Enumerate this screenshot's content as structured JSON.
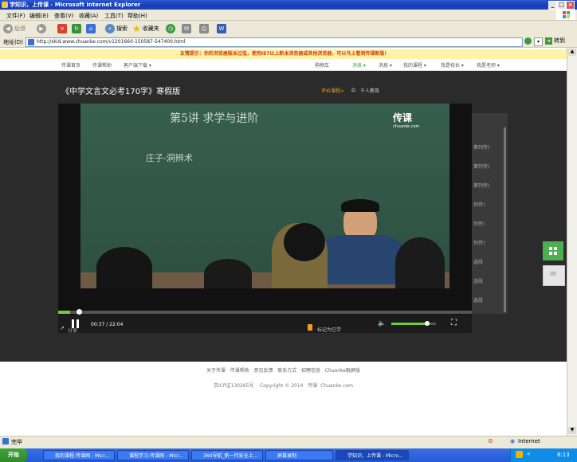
{
  "window": {
    "title": "学知识，上传课 - Microsoft Internet Explorer"
  },
  "menu": [
    "文件(F)",
    "编辑(E)",
    "查看(V)",
    "收藏(A)",
    "工具(T)",
    "帮助(H)"
  ],
  "toolbar": {
    "back": "后退",
    "search": "搜索",
    "favorites": "收藏夹"
  },
  "address": {
    "label": "地址(D)",
    "url": "http://skid.www.chuanke.com/v1201660-150587-547400.html",
    "go": "转到"
  },
  "notice": "友情提示：你的浏览器版本过低，使用IE7以上新本浏览器或其他浏览器，可以马上看到传课新版!",
  "sitenav": {
    "left": [
      "传课首页",
      "传课帮助",
      "客户端下载 ▾"
    ],
    "right": [
      "购物车",
      "消息 ▾",
      "消息 ▾",
      "我的课程 ▾",
      "我是校长 ▾",
      "我是老师 ▾"
    ]
  },
  "course": {
    "title": "《中学文言文必考170字》寒假版",
    "rating_label": "评价课程>",
    "org": "千人教育"
  },
  "video": {
    "board_text_1": "第5讲  求学与进阶",
    "board_text_2": "庄子-洞辨术",
    "logo": "传课",
    "logo_sub": "chuanke.com",
    "time": "00:37 / 22:04",
    "share": "分享",
    "bookmark": "标记为已学",
    "progress": 0.028,
    "volume": 0.8
  },
  "sidebar": [
    "第列传)",
    "第列传)",
    "第列传)",
    "列传)",
    "列传)",
    "列传)",
    "选段",
    "选段",
    "选段"
  ],
  "footer": {
    "links": [
      "关于传课",
      "传课帮助",
      "意见反馈",
      "联系方式",
      "招聘信息",
      "Chuanke融屏版"
    ],
    "icp": "京ICP证130265号",
    "copyright": "Copyright © 2014",
    "brand": "传课",
    "domain": "Chuanke.com"
  },
  "status": {
    "left": "完毕",
    "zone": "Internet"
  },
  "taskbar": {
    "start": "开始",
    "tasks": [
      "我的课程-传课网 - Micr...",
      "课程学习-传课网 - Micr...",
      "360导航_新一代安全上...",
      "屏幕录制",
      "学知识，上传课 - Micro..."
    ],
    "clock": "8:13"
  },
  "colors": {
    "accent": "#f0a020",
    "notice_bg": "#fff3a8",
    "progress_fill": "#6fcf3f",
    "dark_bg": "#2b2b2b"
  }
}
